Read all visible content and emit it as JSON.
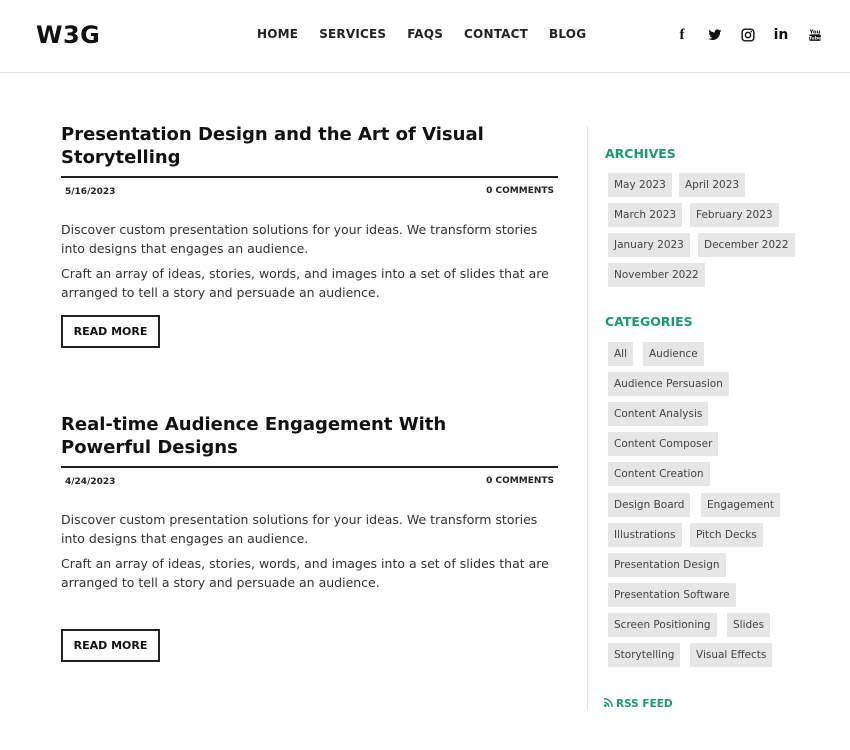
{
  "header": {
    "logo": "W3G",
    "nav": [
      "HOME",
      "SERVICES",
      "FAQS",
      "CONTACT",
      "BLOG"
    ],
    "social": [
      {
        "name": "facebook-icon",
        "glyph": "f"
      },
      {
        "name": "twitter-icon",
        "glyph": "🐦"
      },
      {
        "name": "instagram-icon",
        "glyph": "◎"
      },
      {
        "name": "linkedin-icon",
        "glyph": "in"
      },
      {
        "name": "youtube-icon",
        "glyph": "▶"
      }
    ]
  },
  "posts": [
    {
      "title": "Presentation Design and the Art of Visual Storytelling",
      "date": "5/16/2023",
      "comments": "0 COMMENTS",
      "para1": "Discover custom presentation solutions for your ideas. We transform stories into designs that engages an audience.",
      "para2": "Craft an array of ideas, stories, words, and images into a set of slides that are arranged to tell a story and persuade an audience.",
      "read_more": "READ MORE"
    },
    {
      "title": "Real-time Audience Engagement With Powerful Designs",
      "date": "4/24/2023",
      "comments": "0 COMMENTS",
      "para1": "Discover custom presentation solutions for your ideas. We transform stories into designs that engages an audience.",
      "para2": "Craft an array of ideas, stories, words, and images into a set of slides that are arranged to tell a story and persuade an audience.",
      "read_more": "READ MORE"
    }
  ],
  "sidebar": {
    "archives_heading": "ARCHIVES",
    "archives": [
      "May 2023",
      "April 2023",
      "March 2023",
      "February 2023",
      "January 2023",
      "December 2022",
      "November 2022"
    ],
    "categories_heading": "CATEGORIES",
    "categories": [
      "All",
      "Audience",
      "Audience Persuasion",
      "Content Analysis",
      "Content Composer",
      "Content Creation",
      "Design Board",
      "Engagement",
      "Illustrations",
      "Pitch Decks",
      "Presentation Design",
      "Presentation Software",
      "Screen Positioning",
      "Slides",
      "Storytelling",
      "Visual Effects"
    ],
    "rss": "RSS FEED"
  },
  "colors": {
    "accent": "#1a9b72",
    "tag_bg": "#e6e6e6"
  }
}
